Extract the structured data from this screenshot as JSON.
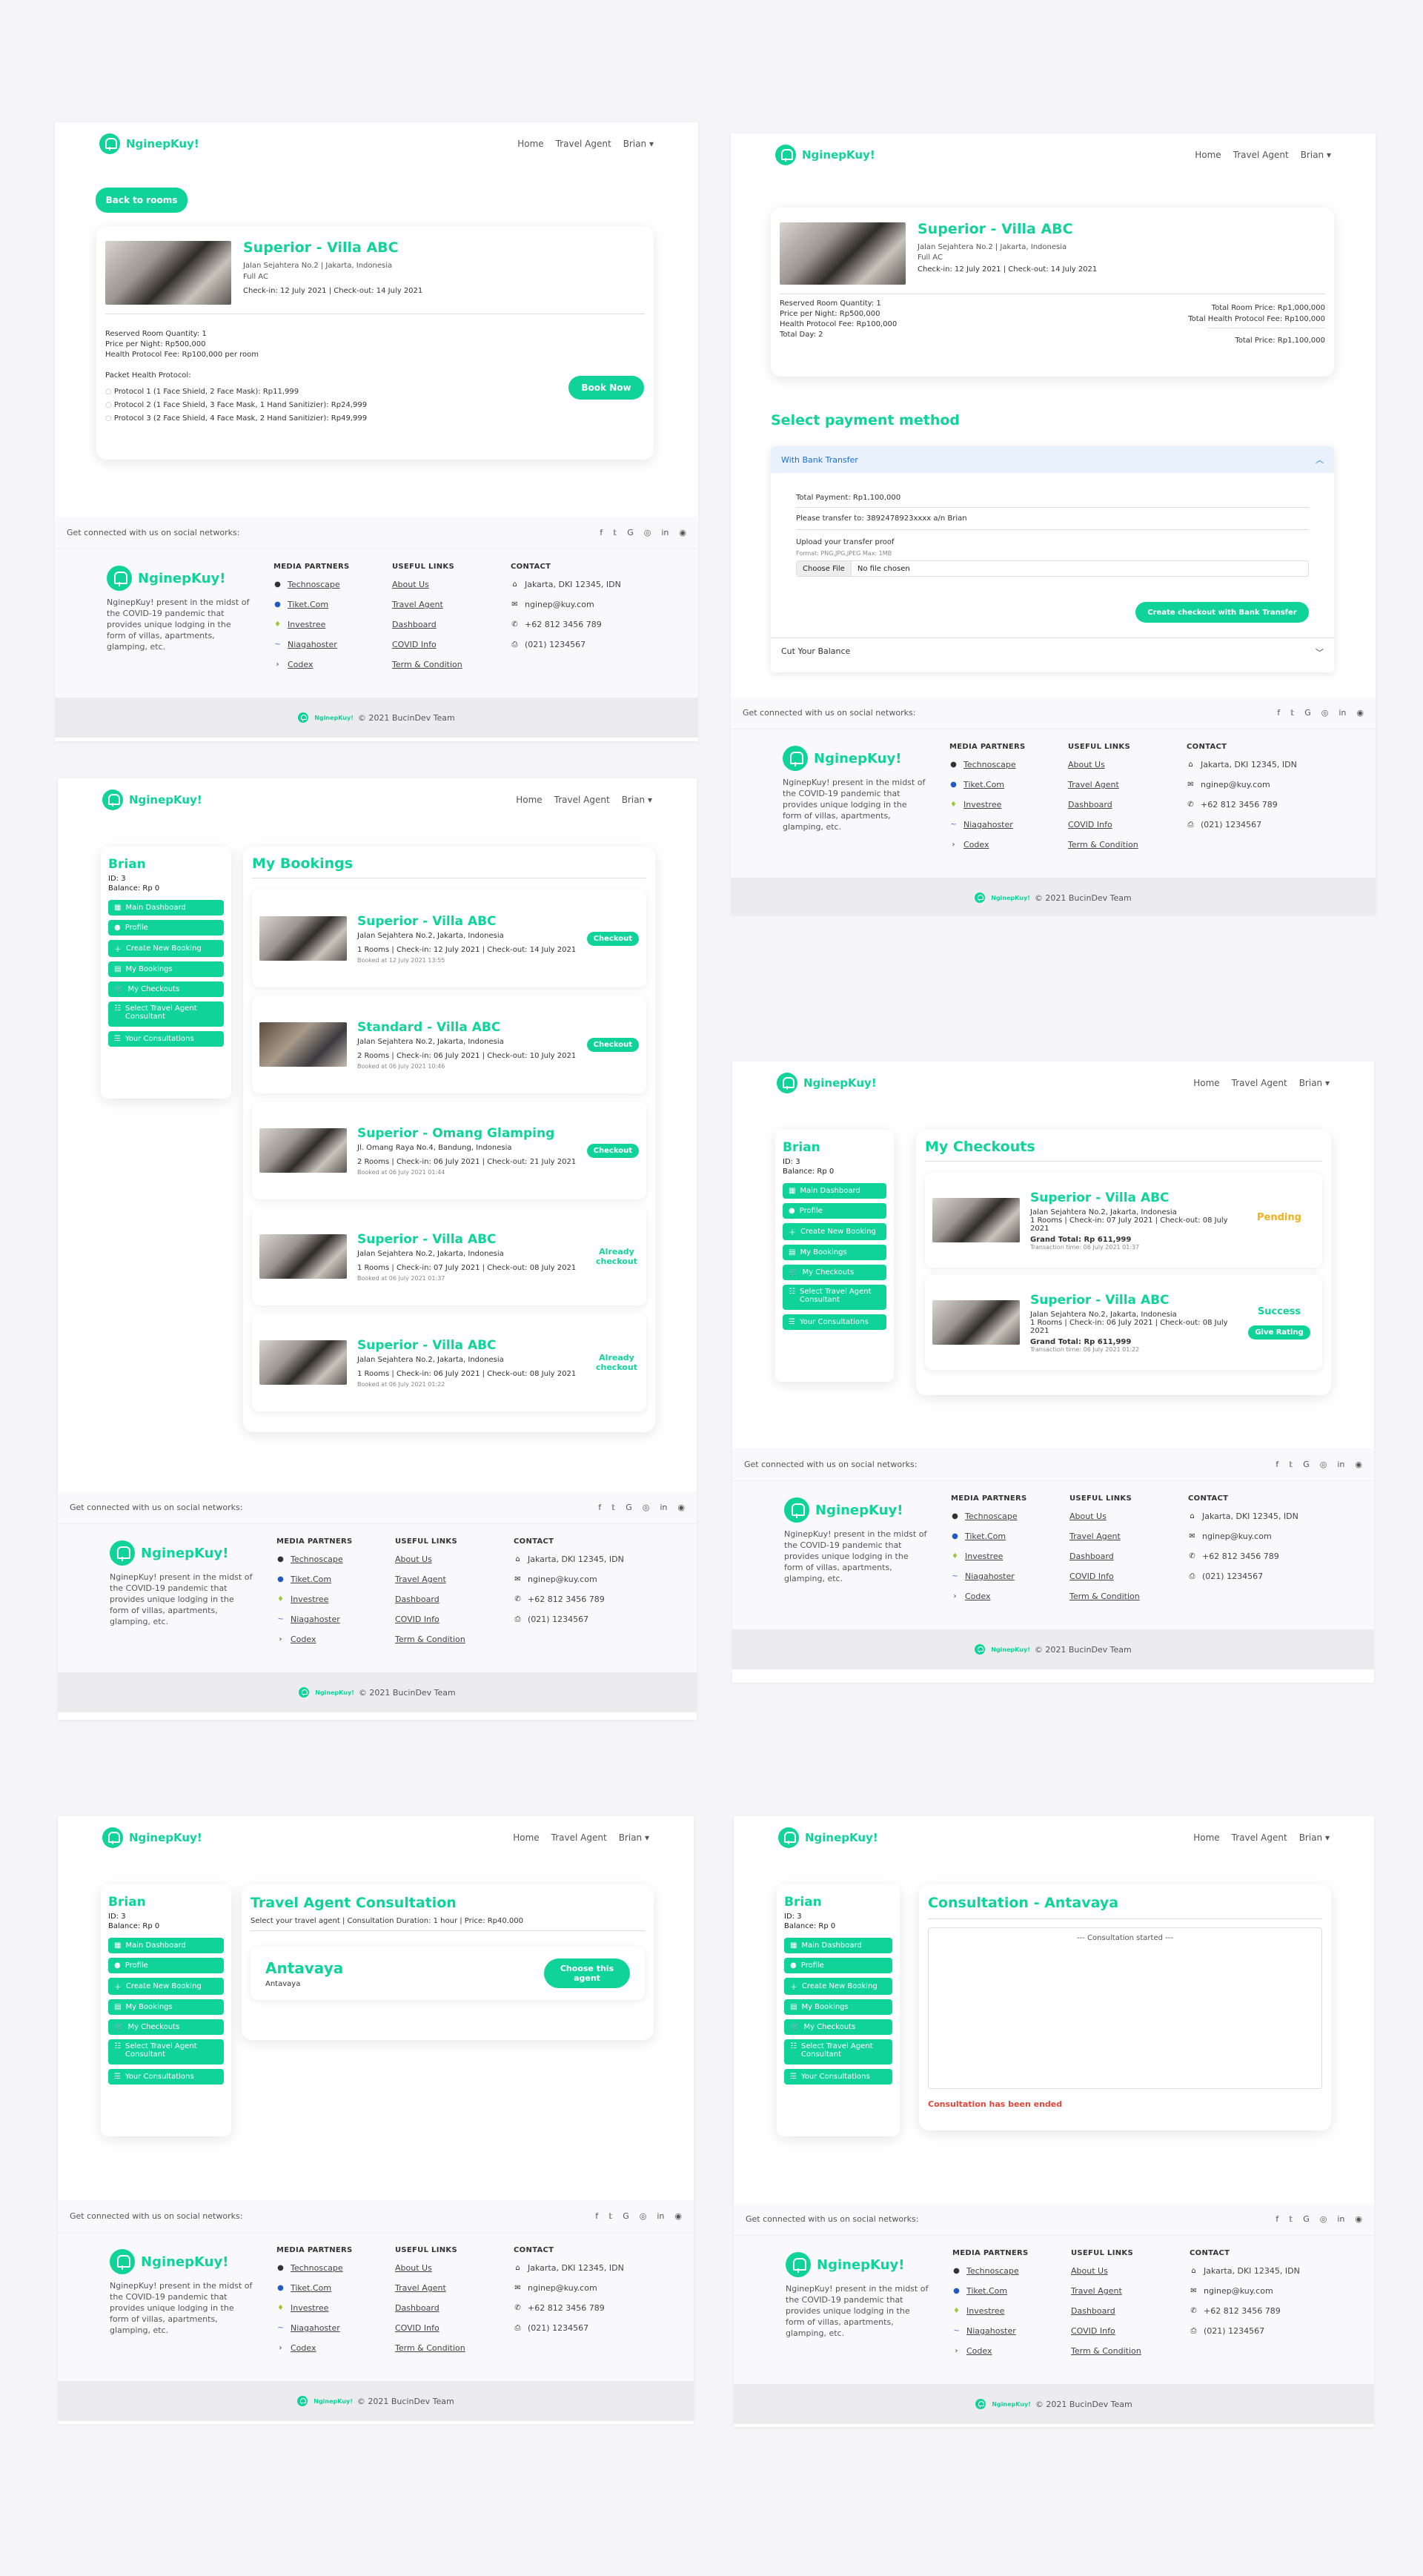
{
  "brand": "NginepKuy!",
  "nav": {
    "home": "Home",
    "agent": "Travel Agent",
    "user": "Brian"
  },
  "footer": {
    "social_text": "Get connected with us on social networks:",
    "social_icons": [
      "facebook-icon",
      "twitter-icon",
      "google-icon",
      "instagram-icon",
      "linkedin-icon",
      "github-icon"
    ],
    "about": "NginepKuy! present in the midst of the COVID-19 pandemic that provides unique lodging in the form of villas, apartments, glamping, etc.",
    "media_title": "MEDIA PARTNERS",
    "media": [
      "Technoscape",
      "Tiket.Com",
      "Investree",
      "Niagahoster",
      "Codex"
    ],
    "links_title": "USEFUL LINKS",
    "links": [
      "About Us",
      "Travel Agent",
      "Dashboard",
      "COVID Info",
      "Term & Condition"
    ],
    "contact_title": "CONTACT",
    "contact": [
      "Jakarta, DKI 12345, IDN",
      "nginep@kuy.com",
      "+62 812 3456 789",
      "(021) 1234567"
    ],
    "copyright": "© 2021 BucinDev Team"
  },
  "detail": {
    "back": "Back to rooms",
    "name": "Superior - Villa ABC",
    "address": "Jalan Sejahtera No.2 | Jakarta, Indonesia",
    "feature": "Full AC",
    "dates": "Check-in: 12 July 2021 | Check-out: 14 July 2021",
    "qty": "Reserved Room Quantity: 1",
    "price": "Price per Night: Rp500,000",
    "fee": "Health Protocol Fee: Rp100,000 per room",
    "packet_title": "Packet Health Protocol:",
    "protocols": [
      "Protocol 1 (1 Face Shield, 2 Face Mask): Rp11,999",
      "Protocol 2 (1 Face Shield, 3 Face Mask, 1 Hand Sanitizier): Rp24,999",
      "Protocol 3 (2 Face Shield, 4 Face Mask, 2 Hand Sanitizier): Rp49,999"
    ],
    "book": "Book Now"
  },
  "payment": {
    "name": "Superior - Villa ABC",
    "address": "Jalan Sejahtera No.2 | Jakarta, Indonesia",
    "feature": "Full AC",
    "dates": "Check-in: 12 July 2021 | Check-out: 14 July 2021",
    "qty": "Reserved Room Quantity: 1",
    "price": "Price per Night: Rp500,000",
    "fee": "Health Protocol Fee: Rp100,000",
    "days": "Total Day: 2",
    "total_room": "Total Room Price: Rp1,000,000",
    "total_fee": "Total Health Protocol Fee: Rp100,000",
    "total": "Total Price: Rp1,100,000",
    "method_title": "Select payment method",
    "bank_label": "With Bank Transfer",
    "total_payment": "Total Payment: Rp1,100,000",
    "transfer": "Please transfer to: 3892478923xxxx a/n Brian",
    "upload": "Upload your transfer proof",
    "format": "Format: PNG,JPG,JPEG Max: 1MB",
    "choose": "Choose File",
    "nofile": "No file chosen",
    "checkout": "Create checkout with Bank Transfer",
    "balance_label": "Cut Your Balance"
  },
  "user": {
    "name": "Brian",
    "id": "ID: 3",
    "balance": "Balance: Rp 0",
    "menu": [
      "Main Dashboard",
      "Profile",
      "Create New Booking",
      "My Bookings",
      "My Checkouts",
      "Select Travel Agent Consultant",
      "Your Consultations"
    ]
  },
  "bookings": {
    "title": "My Bookings",
    "items": [
      {
        "name": "Superior - Villa ABC",
        "addr": "Jalan Sejahtera No.2, Jakarta, Indonesia",
        "info": "1 Rooms | Check-in: 12 July 2021 | Check-out: 14 July 2021",
        "booked": "Booked at 12 July 2021 13:55",
        "action": "Checkout"
      },
      {
        "name": "Standard - Villa ABC",
        "addr": "Jalan Sejahtera No.2, Jakarta, Indonesia",
        "info": "2 Rooms | Check-in: 06 July 2021 | Check-out: 10 July 2021",
        "booked": "Booked at 06 July 2021 10:46",
        "action": "Checkout"
      },
      {
        "name": "Superior - Omang Glamping",
        "addr": "Jl. Omang Raya No.4, Bandung, Indonesia",
        "info": "2 Rooms | Check-in: 06 July 2021 | Check-out: 21 July 2021",
        "booked": "Booked at 06 July 2021 01:44",
        "action": "Checkout"
      },
      {
        "name": "Superior - Villa ABC",
        "addr": "Jalan Sejahtera No.2, Jakarta, Indonesia",
        "info": "1 Rooms | Check-in: 07 July 2021 | Check-out: 08 July 2021",
        "booked": "Booked at 06 July 2021 01:37",
        "action": "Already checkout"
      },
      {
        "name": "Superior - Villa ABC",
        "addr": "Jalan Sejahtera No.2, Jakarta, Indonesia",
        "info": "1 Rooms | Check-in: 06 July 2021 | Check-out: 08 July 2021",
        "booked": "Booked at 06 July 2021 01:22",
        "action": "Already checkout"
      }
    ]
  },
  "checkouts": {
    "title": "My Checkouts",
    "items": [
      {
        "name": "Superior - Villa ABC",
        "addr": "Jalan Sejahtera No.2, Jakarta, Indonesia",
        "info": "1 Rooms | Check-in: 07 July 2021 | Check-out: 08 July 2021",
        "total": "Grand Total: Rp 611,999",
        "time": "Transaction time: 06 July 2021 01:37",
        "status": "Pending"
      },
      {
        "name": "Superior - Villa ABC",
        "addr": "Jalan Sejahtera No.2, Jakarta, Indonesia",
        "info": "1 Rooms | Check-in: 06 July 2021 | Check-out: 08 July 2021",
        "total": "Grand Total: Rp 611,999",
        "time": "Transaction time: 06 July 2021 01:22",
        "status": "Success",
        "action": "Give Rating"
      }
    ]
  },
  "consultation": {
    "title": "Travel Agent Consultation",
    "subtitle": "Select your travel agent | Consultation Duration: 1 hour | Price: Rp40.000",
    "agent": "Antavaya",
    "agent_sub": "Antavaya",
    "choose": "Choose this agent"
  },
  "chat": {
    "title": "Consultation - Antavaya",
    "started": "--- Consultation started ---",
    "ended": "Consultation has been ended"
  },
  "colors": {
    "accent": "#10d39a",
    "pending": "#f2b01e",
    "ended": "#e0463a"
  }
}
